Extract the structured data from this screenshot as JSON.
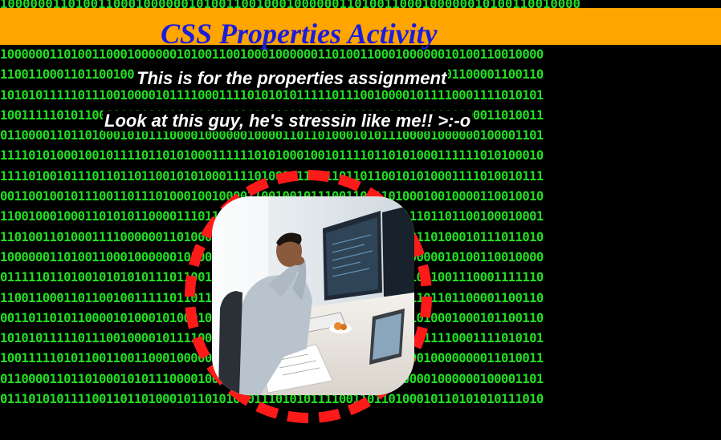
{
  "header": {
    "title": "CSS Properties Activity",
    "background_color": "#ffa500",
    "title_color": "#1c1cdc"
  },
  "captions": {
    "line1": "This is for the properties assignment",
    "line2": "Look at this guy, he's stressin like me!! >:-o"
  },
  "background": {
    "color": "#000000",
    "digit_color": "#22dd22",
    "rows": [
      "10000001101001100010000001010011001000100000011010011000100000010100110010000",
      "11001100011011001001111101101100001111001100011011001001111101101100001100110",
      "10101011111011100100001011110001111010101011111011100100001011110001111010101",
      "10011111010110011001100010000000011010011111010110011001100010000000011010011",
      "01100001101101000101011100001000000100001101101000101011100001000000100001101",
      "11110101000100101111011010100011111101010001001011110110101000111111010100010",
      "11110100101110110110110010101000111101001011101101101100101010001111010010111",
      "00110010010111001101110100010010000110010010111001101110100010010000110010010",
      "11001000100011010101100001110110110010001000110101011000011101101100100010001",
      "11010011010001111000000110100010111011010011010001111000000110100010111011010",
      "10000001101001100010000001010011001000100000011010011000100000010100110010000",
      "01111101101001010101011101100111000111111011010010101010111011001110001111110",
      "11001100011011001001111101101100001111001100011011001001111101101100001100110",
      "00110110101100001010001010001000101100110110101100001010001010001000101100110",
      "10101011111011100100001011110001111010101011111011100100001011110001111010101",
      "10011111010110011001100010000000011010011111010110011001100010000000011010011",
      "01100001101101000101011100001000000100001101101000101011100001000000100001101",
      "01110101011110011011010001011010101011101010111100110110100010110101010111010"
    ]
  },
  "image": {
    "description_icon": "stressed-man-at-desk-photo",
    "ring_color": "#ff1a1a"
  }
}
